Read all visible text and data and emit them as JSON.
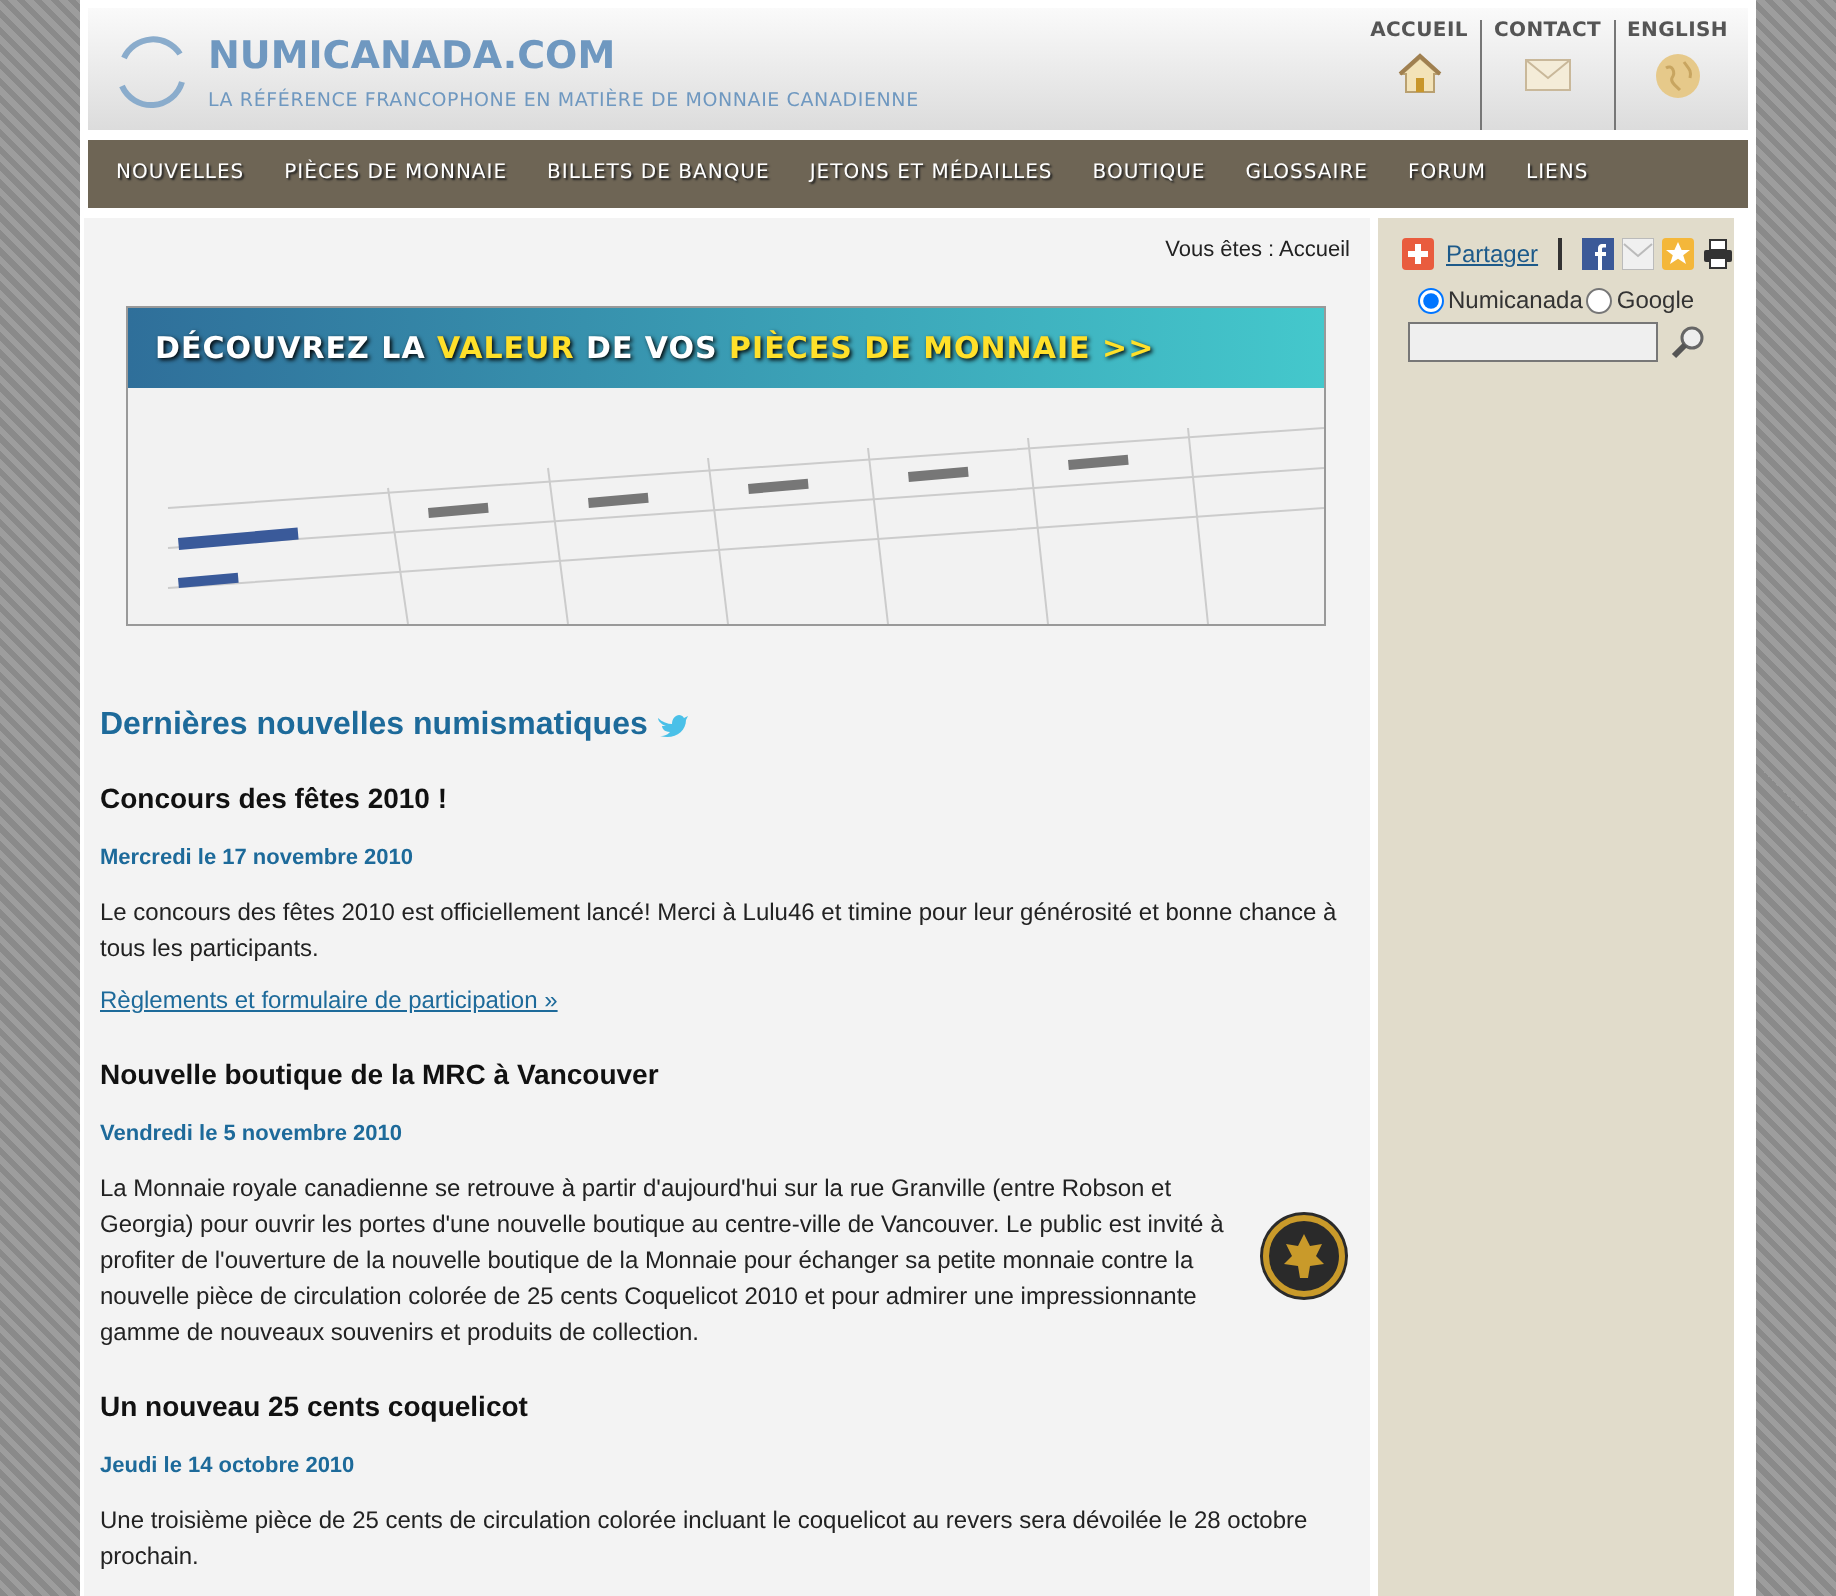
{
  "header": {
    "site_name": "NUMICANADA.COM",
    "tagline": "LA RÉFÉRENCE FRANCOPHONE EN MATIÈRE DE MONNAIE CANADIENNE",
    "top_links": [
      {
        "label": "ACCUEIL"
      },
      {
        "label": "CONTACT"
      },
      {
        "label": "ENGLISH"
      }
    ]
  },
  "nav": [
    "NOUVELLES",
    "PIÈCES DE MONNAIE",
    "BILLETS DE BANQUE",
    "JETONS ET MÉDAILLES",
    "BOUTIQUE",
    "GLOSSAIRE",
    "FORUM",
    "LIENS"
  ],
  "breadcrumb": "Vous êtes : Accueil",
  "banner": {
    "parts": [
      {
        "text": "DÉCOUVREZ LA ",
        "highlight": false
      },
      {
        "text": "VALEUR",
        "highlight": true
      },
      {
        "text": " DE VOS ",
        "highlight": false
      },
      {
        "text": "PIÈCES DE MONNAIE >>",
        "highlight": true
      }
    ]
  },
  "news_heading": "Dernières nouvelles numismatiques",
  "news": [
    {
      "title": "Concours des fêtes 2010 !",
      "date": "Mercredi le 17 novembre 2010",
      "body": "Le concours des fêtes 2010 est officiellement lancé! Merci à Lulu46 et timine pour leur générosité et bonne chance à tous les participants.",
      "link": "Règlements et formulaire de participation »",
      "logo": false
    },
    {
      "title": "Nouvelle boutique de la MRC à Vancouver",
      "date": "Vendredi le 5 novembre 2010",
      "body": "La Monnaie royale canadienne se retrouve à partir d'aujourd'hui sur la rue Granville (entre Robson et Georgia) pour ouvrir les portes d'une nouvelle boutique au centre-ville de Vancouver. Le public est invité à profiter de l'ouverture de la nouvelle boutique de la Monnaie pour échanger sa petite monnaie contre la nouvelle pièce de circulation colorée de 25 cents Coquelicot 2010 et pour admirer une impressionnante gamme de nouveaux souvenirs et produits de collection.",
      "logo": true
    },
    {
      "title": "Un nouveau 25 cents coquelicot",
      "date": "Jeudi le 14 octobre 2010",
      "body": "Une troisième pièce de 25 cents de circulation colorée incluant le coquelicot au revers sera dévoilée le 28 octobre prochain.",
      "logo": false
    }
  ],
  "sidebar": {
    "share": "Partager",
    "search_options": [
      {
        "label": "Numicanada",
        "selected": true
      },
      {
        "label": "Google",
        "selected": false
      }
    ]
  }
}
